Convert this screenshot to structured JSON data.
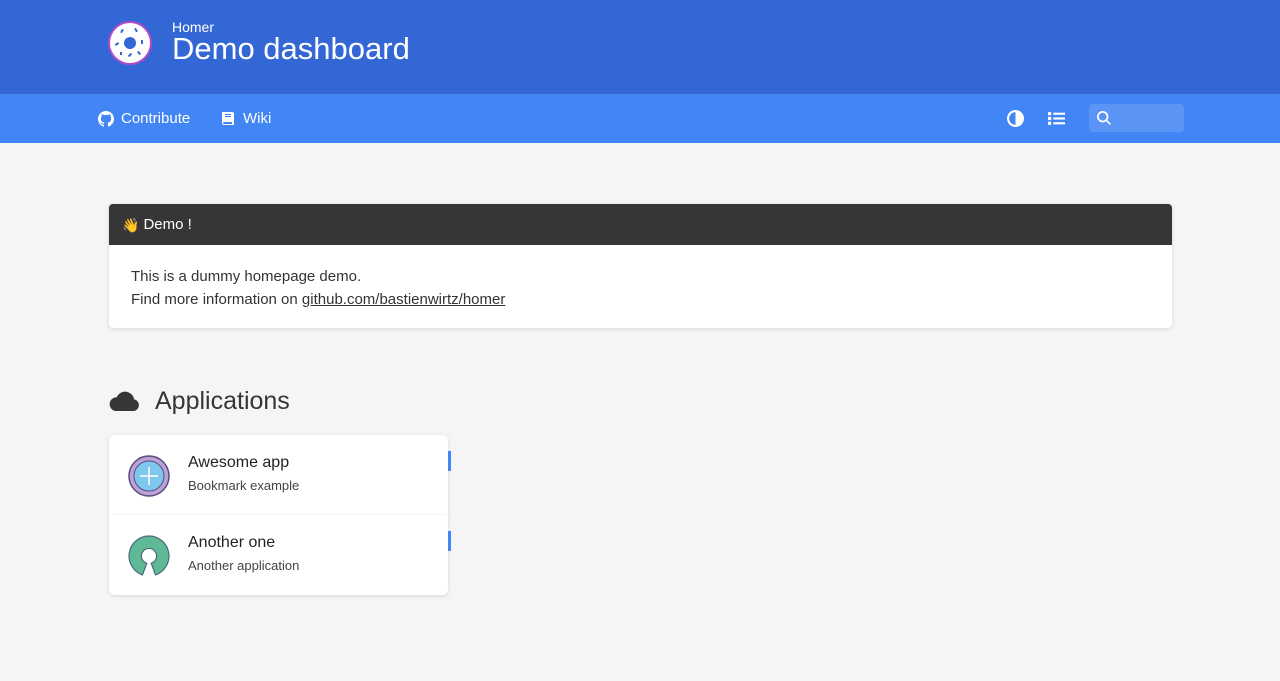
{
  "header": {
    "subtitle": "Homer",
    "title": "Demo dashboard"
  },
  "nav": {
    "links": [
      {
        "label": "Contribute",
        "icon": "github-icon"
      },
      {
        "label": "Wiki",
        "icon": "book-icon"
      }
    ],
    "theme_toggle_icon": "contrast-icon",
    "layout_toggle_icon": "list-icon",
    "search": {
      "icon": "search-icon",
      "placeholder": "",
      "value": ""
    }
  },
  "message": {
    "emoji": "👋",
    "title": "Demo !",
    "line1": "This is a dummy homepage demo.",
    "line2_prefix": "Find more information on ",
    "link_text": "github.com/bastienwirtz/homer"
  },
  "group": {
    "icon": "cloud-icon",
    "name": "Applications",
    "items": [
      {
        "name": "Awesome app",
        "subtitle": "Bookmark example",
        "icon": "plus-circle-logo"
      },
      {
        "name": "Another one",
        "subtitle": "Another application",
        "icon": "open-source-logo"
      }
    ]
  },
  "colors": {
    "header": "#3367d6",
    "navbar": "#4285f4",
    "background": "#f5f5f5",
    "message_header": "#363636",
    "tag": "#4285f4"
  }
}
